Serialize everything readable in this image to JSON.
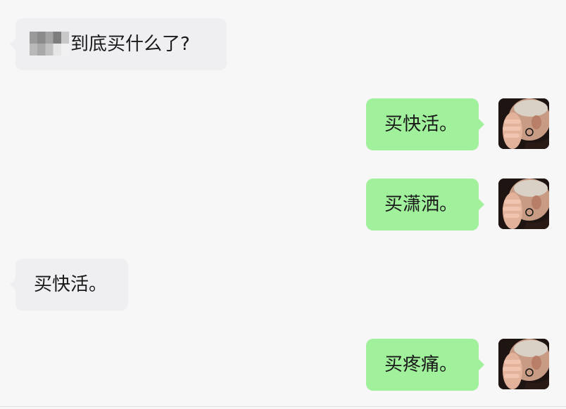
{
  "conversation": {
    "messages": [
      {
        "side": "left",
        "text": "到底买什么了?",
        "redacted_prefix": true
      },
      {
        "side": "right",
        "text": "买快活。",
        "avatar": "user-avatar-photo"
      },
      {
        "side": "right",
        "text": "买潇洒。",
        "avatar": "user-avatar-photo"
      },
      {
        "side": "left",
        "text": "买快活。"
      },
      {
        "side": "right",
        "text": "买疼痛。",
        "avatar": "user-avatar-photo"
      }
    ]
  },
  "colors": {
    "background": "#f7f7f8",
    "incoming_bubble": "#efeff2",
    "outgoing_bubble": "#a0f09c",
    "text": "#191919"
  }
}
